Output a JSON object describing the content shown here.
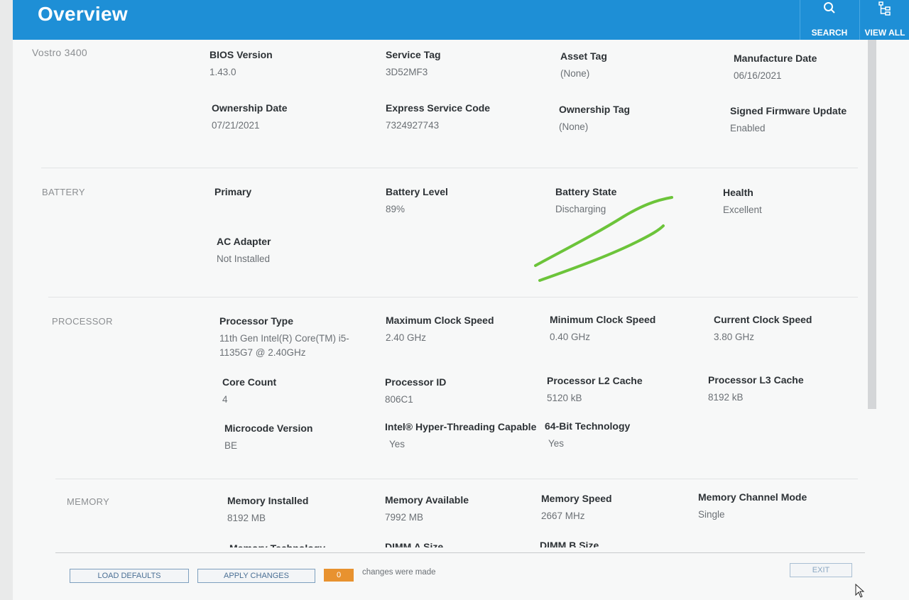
{
  "header": {
    "title": "Overview",
    "search_label": "SEARCH",
    "view_all_label": "VIEW ALL",
    "search_icon": "search-icon",
    "view_all_icon": "list-tree-icon"
  },
  "colors": {
    "accent": "#1e8fd6",
    "badge": "#e8922f",
    "annotation": "#6cc43a"
  },
  "system": {
    "model": "Vostro 3400",
    "fields": [
      {
        "key": "BIOS Version",
        "value": "1.43.0"
      },
      {
        "key": "Service Tag",
        "value": "3D52MF3"
      },
      {
        "key": "Asset Tag",
        "value": "(None)"
      },
      {
        "key": "Manufacture Date",
        "value": "06/16/2021"
      },
      {
        "key": "Ownership Date",
        "value": "07/21/2021"
      },
      {
        "key": "Express Service Code",
        "value": "7324927743"
      },
      {
        "key": "Ownership Tag",
        "value": "(None)"
      },
      {
        "key": "Signed Firmware Update",
        "value": "Enabled"
      }
    ]
  },
  "battery": {
    "label": "BATTERY",
    "fields": [
      {
        "key": "Primary",
        "value": ""
      },
      {
        "key": "Battery Level",
        "value": "89%"
      },
      {
        "key": "Battery State",
        "value": "Discharging"
      },
      {
        "key": "Health",
        "value": "Excellent"
      },
      {
        "key": "AC Adapter",
        "value": "Not Installed"
      }
    ]
  },
  "processor": {
    "label": "PROCESSOR",
    "fields": [
      {
        "key": "Processor Type",
        "value": "11th Gen Intel(R) Core(TM) i5-1135G7 @ 2.40GHz"
      },
      {
        "key": "Maximum Clock Speed",
        "value": "2.40 GHz"
      },
      {
        "key": "Minimum Clock Speed",
        "value": "0.40 GHz"
      },
      {
        "key": "Current Clock Speed",
        "value": "3.80 GHz"
      },
      {
        "key": "Core Count",
        "value": "4"
      },
      {
        "key": "Processor ID",
        "value": "806C1"
      },
      {
        "key": "Processor L2 Cache",
        "value": "5120 kB"
      },
      {
        "key": "Processor L3 Cache",
        "value": "8192 kB"
      },
      {
        "key": "Microcode Version",
        "value": "BE"
      },
      {
        "key": "Intel® Hyper-Threading Capable",
        "value": "Yes"
      },
      {
        "key": "64-Bit Technology",
        "value": "Yes"
      }
    ]
  },
  "memory": {
    "label": "MEMORY",
    "fields": [
      {
        "key": "Memory Installed",
        "value": "8192 MB"
      },
      {
        "key": "Memory Available",
        "value": "7992 MB"
      },
      {
        "key": "Memory Speed",
        "value": "2667 MHz"
      },
      {
        "key": "Memory Channel Mode",
        "value": "Single"
      },
      {
        "key": "Memory Technology",
        "value": ""
      },
      {
        "key": "DIMM A Size",
        "value": ""
      },
      {
        "key": "DIMM B Size",
        "value": ""
      }
    ]
  },
  "footer": {
    "load_defaults": "LOAD DEFAULTS",
    "apply_changes": "APPLY CHANGES",
    "changes_count": "0",
    "changes_text": "changes were made",
    "exit": "EXIT"
  }
}
